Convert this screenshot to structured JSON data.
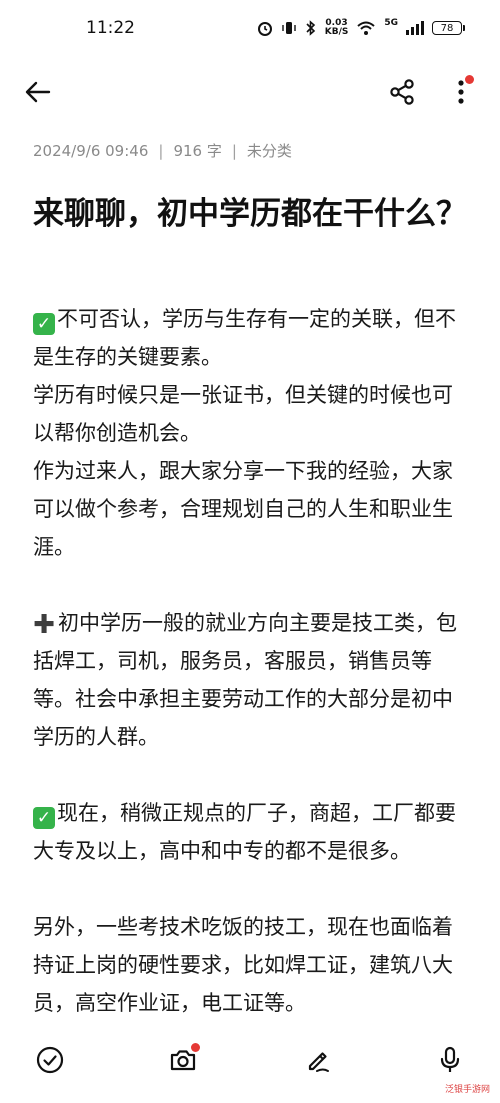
{
  "status_bar": {
    "time": "11:22",
    "net_speed_value": "0.03",
    "net_speed_unit": "KB/S",
    "network_type": "5G",
    "battery": "78"
  },
  "toolbar": {
    "back_icon": "arrow-left-icon",
    "share_icon": "share-icon",
    "more_icon": "more-vertical-icon"
  },
  "meta": {
    "date": "2024/9/6 09:46",
    "word_count": "916 字",
    "category": "未分类",
    "separator": "|"
  },
  "article": {
    "title": "来聊聊，初中学历都在干什么？",
    "paragraphs": [
      {
        "emoji": "check",
        "text": "不可否认，学历与生存有一定的关联，但不是生存的关键要素。"
      },
      {
        "emoji": "",
        "text": "学历有时候只是一张证书，但关键的时候也可以帮你创造机会。"
      },
      {
        "emoji": "",
        "text": "作为过来人，跟大家分享一下我的经验，大家可以做个参考，合理规划自己的人生和职业生涯。"
      },
      {
        "emoji": "plus",
        "text": "初中学历一般的就业方向主要是技工类，包括焊工，司机，服务员，客服员，销售员等等。社会中承担主要劳动工作的大部分是初中学历的人群。"
      },
      {
        "emoji": "check",
        "text": "现在，稍微正规点的厂子，商超，工厂都要大专及以上，高中和中专的都不是很多。"
      },
      {
        "emoji": "",
        "text": "另外，一些考技术吃饭的技工，现在也面临着持证上岗的硬性要求，比如焊工证，建筑八大员，高空作业证，电工证等。"
      }
    ]
  },
  "bottom_bar": {
    "items": [
      "checkmark-circle-icon",
      "camera-icon",
      "pen-icon",
      "microphone-icon"
    ]
  },
  "colors": {
    "accent_red": "#e53935",
    "check_green": "#35b34a",
    "meta_gray": "#8a8a8a"
  },
  "watermark": "泛银手游网"
}
